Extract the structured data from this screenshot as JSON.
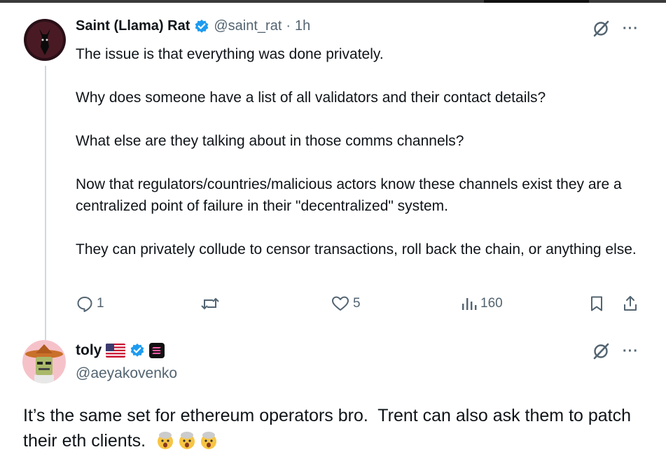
{
  "tweet1": {
    "author_name": "Saint (Llama) Rat",
    "handle": "@saint_rat",
    "separator": "·",
    "time": "1h",
    "text": "The issue is that everything was done privately.\n\nWhy does someone have a list of all validators and their contact details?\n\nWhat else are they talking about in those comms channels?\n\nNow that regulators/countries/malicious actors know these channels exist they are a centralized point of failure in their \"decentralized\" system.\n\nThey can privately collude to censor transactions, roll back the chain, or anything else.",
    "actions": {
      "replies": "1",
      "reposts": "",
      "likes": "5",
      "views": "160"
    },
    "more_label": "···"
  },
  "tweet2": {
    "author_name": "toly",
    "handle": "@aeyakovenko",
    "text": "It’s the same set for ethereum operators bro.  Trent can also ask them to patch their eth clients.  ",
    "more_label": "···"
  },
  "colors": {
    "verified_blue": "#1d9bf0",
    "secondary_text": "#536471",
    "thread_line": "#cfd9de"
  }
}
